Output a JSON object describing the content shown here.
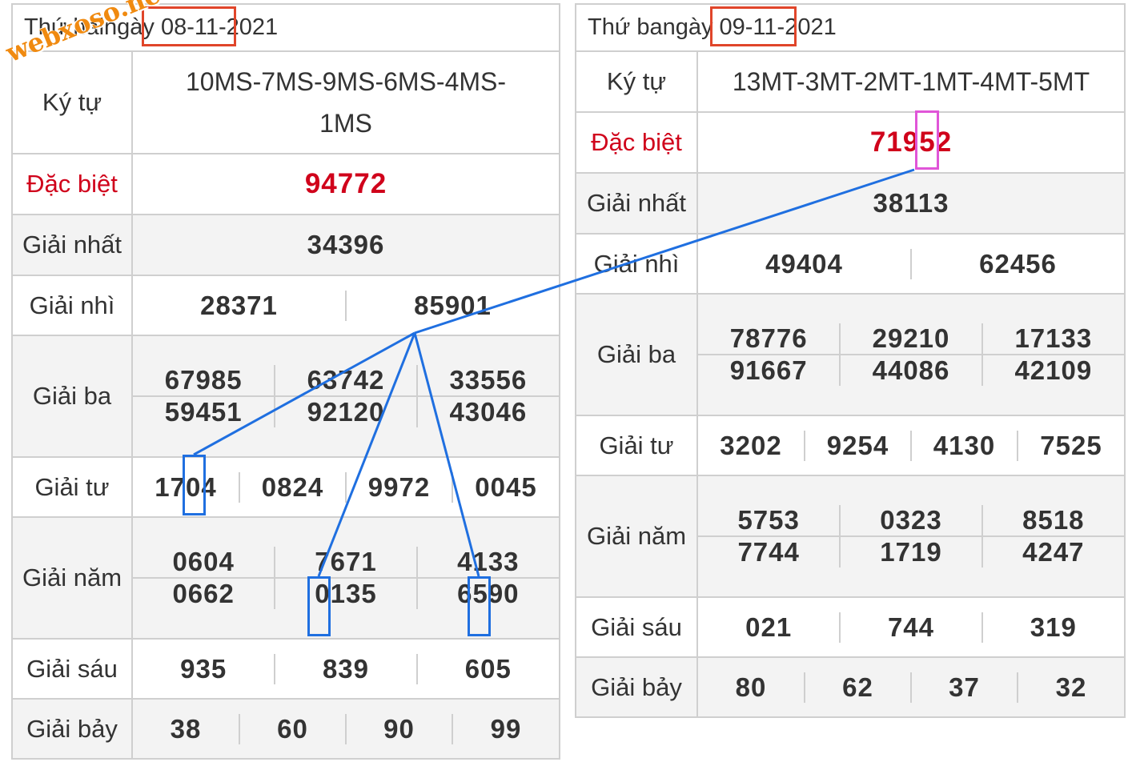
{
  "watermark": "webxoso.net",
  "left": {
    "day": "Thứ hai",
    "date": "ngày 08-11-2021",
    "ky_tu_label": "Ký tự",
    "ky_tu_line1": "10MS-7MS-9MS-6MS-4MS-",
    "ky_tu_line2": "1MS",
    "labels": {
      "dac_biet": "Đặc biệt",
      "nhat": "Giải nhất",
      "nhi": "Giải nhì",
      "ba": "Giải ba",
      "tu": "Giải tư",
      "nam": "Giải năm",
      "sau": "Giải sáu",
      "bay": "Giải bảy"
    },
    "dac_biet": "94772",
    "nhat": "34396",
    "nhi": [
      "28371",
      "85901"
    ],
    "ba": [
      "67985",
      "63742",
      "33556",
      "59451",
      "92120",
      "43046"
    ],
    "tu": [
      "1704",
      "0824",
      "9972",
      "0045"
    ],
    "nam": [
      "0604",
      "7671",
      "4133",
      "0662",
      "0135",
      "6590"
    ],
    "sau": [
      "935",
      "839",
      "605"
    ],
    "bay": [
      "38",
      "60",
      "90",
      "99"
    ]
  },
  "right": {
    "day": "Thứ ba",
    "date": "ngày 09-11-2021",
    "ky_tu_label": "Ký tự",
    "ky_tu_line1": "13MT-3MT-2MT-1MT-4MT-5MT",
    "labels": {
      "dac_biet": "Đặc biệt",
      "nhat": "Giải nhất",
      "nhi": "Giải nhì",
      "ba": "Giải ba",
      "tu": "Giải tư",
      "nam": "Giải năm",
      "sau": "Giải sáu",
      "bay": "Giải bảy"
    },
    "dac_biet": "71952",
    "nhat": "38113",
    "nhi": [
      "49404",
      "62456"
    ],
    "ba": [
      "78776",
      "29210",
      "17133",
      "91667",
      "44086",
      "42109"
    ],
    "tu": [
      "3202",
      "9254",
      "4130",
      "7525"
    ],
    "nam": [
      "5753",
      "0323",
      "8518",
      "7744",
      "1719",
      "4247"
    ],
    "sau": [
      "021",
      "744",
      "319"
    ],
    "bay": [
      "80",
      "62",
      "37",
      "32"
    ]
  },
  "colors": {
    "special_red": "#d0021b",
    "day_highlight": "#e0452a",
    "digit_highlight": "#1f6fe0",
    "special_digit_highlight": "#e055d8",
    "watermark": "#f08a10"
  }
}
